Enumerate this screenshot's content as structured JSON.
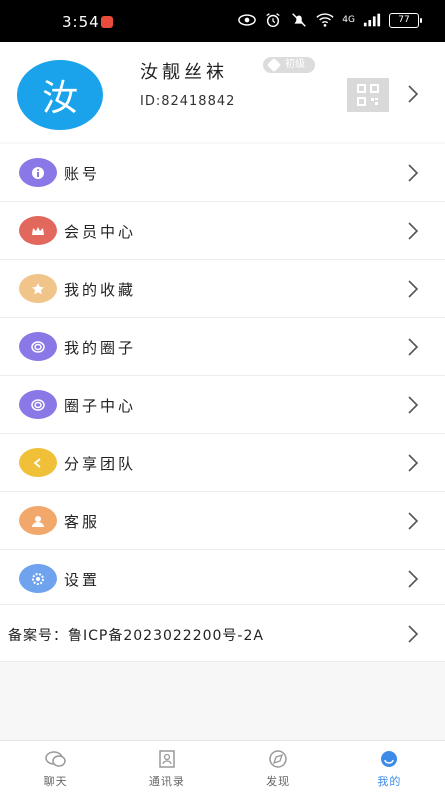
{
  "status_bar": {
    "time": "3:54",
    "network_text": "4G",
    "battery": "77"
  },
  "profile": {
    "avatar_char": "汝",
    "nickname": "汝靓丝袜",
    "level": "初级",
    "id_text": "ID:82418842"
  },
  "menu": {
    "items": [
      {
        "label": "账号",
        "icon": "info-icon",
        "color": "#8a78e6"
      },
      {
        "label": "会员中心",
        "icon": "crown-icon",
        "color": "#e2675c"
      },
      {
        "label": "我的收藏",
        "icon": "star-icon",
        "color": "#f1c48a"
      },
      {
        "label": "我的圈子",
        "icon": "circle-icon",
        "color": "#8a78e6"
      },
      {
        "label": "圈子中心",
        "icon": "circle-center-icon",
        "color": "#8a78e6"
      },
      {
        "label": "分享团队",
        "icon": "share-icon",
        "color": "#f0c038"
      },
      {
        "label": "客服",
        "icon": "service-icon",
        "color": "#f1a86a"
      },
      {
        "label": "设置",
        "icon": "settings-icon",
        "color": "#6fa3ee"
      }
    ]
  },
  "icp": {
    "text": "备案号：鲁ICP备2023022200号-2A"
  },
  "bottom_nav": {
    "tabs": [
      {
        "label": "聊天",
        "icon": "chat-icon",
        "active": false
      },
      {
        "label": "通讯录",
        "icon": "contacts-icon",
        "active": false
      },
      {
        "label": "发现",
        "icon": "discover-icon",
        "active": false
      },
      {
        "label": "我的",
        "icon": "me-icon",
        "active": true
      }
    ]
  },
  "colors": {
    "accent": "#3d8be8",
    "avatar_bg": "#1aa3ea"
  }
}
